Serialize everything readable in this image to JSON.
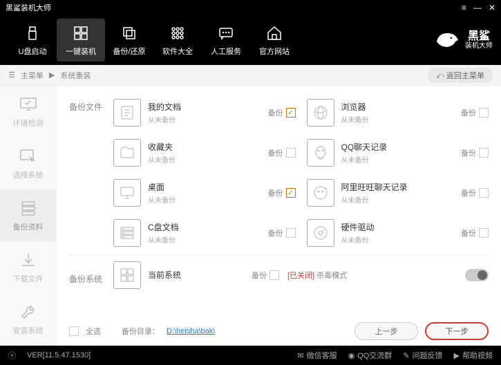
{
  "titlebar": {
    "title": "黑鲨装机大师"
  },
  "nav": [
    {
      "label": "U盘启动"
    },
    {
      "label": "一键装机"
    },
    {
      "label": "备份/还原"
    },
    {
      "label": "软件大全"
    },
    {
      "label": "人工服务"
    },
    {
      "label": "官方网站"
    }
  ],
  "logo": {
    "main": "黑鲨",
    "sub": "装机大师"
  },
  "breadcrumb": {
    "root": "主菜单",
    "current": "系统重装",
    "back": "返回主菜单"
  },
  "sidebar": [
    {
      "label": "环境检测"
    },
    {
      "label": "选择系统"
    },
    {
      "label": "备份资料"
    },
    {
      "label": "下载文件"
    },
    {
      "label": "安装系统"
    }
  ],
  "sections": {
    "files_label": "备份文件",
    "system_label": "备份系统",
    "chk_label": "备份",
    "never": "从未备份"
  },
  "items_left": [
    {
      "name": "我的文档",
      "checked": true
    },
    {
      "name": "收藏夹",
      "checked": false
    },
    {
      "name": "桌面",
      "checked": true
    },
    {
      "name": "C盘文档",
      "checked": false
    }
  ],
  "items_right": [
    {
      "name": "浏览器"
    },
    {
      "name": "QQ聊天记录"
    },
    {
      "name": "阿里旺旺聊天记录"
    },
    {
      "name": "硬件驱动"
    }
  ],
  "system_item": {
    "name": "当前系统"
  },
  "kill_mode": {
    "prefix": "[已关闭]",
    "label": "杀毒模式"
  },
  "bottom": {
    "select_all": "全选",
    "dir_label": "备份目录：",
    "dir_path": "D:\\heisha\\bak\\",
    "prev": "上一步",
    "next": "下一步"
  },
  "status": {
    "ver": "VER[11.5.47.1530]",
    "wechat": "微信客服",
    "qq": "QQ交流群",
    "feedback": "问题反馈",
    "help": "帮助视频"
  }
}
